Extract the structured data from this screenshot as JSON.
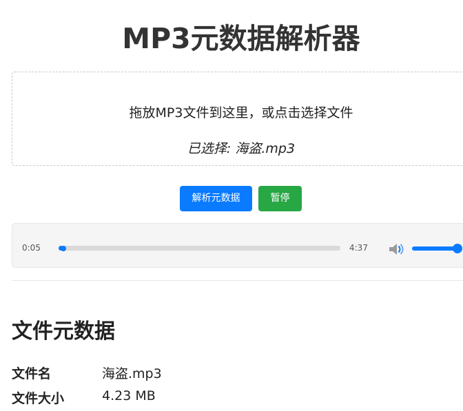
{
  "page": {
    "title": "MP3元数据解析器"
  },
  "dropzone": {
    "hint": "拖放MP3文件到这里，或点击选择文件",
    "selected": "已选择: 海盗.mp3"
  },
  "actions": {
    "parse_label": "解析元数据",
    "pause_label": "暂停"
  },
  "player": {
    "current_time": "0:05",
    "total_time": "4:37",
    "progress": 0.018,
    "volume": 1.0,
    "volume_icon": "speaker-icon"
  },
  "metadata": {
    "heading": "文件元数据",
    "rows": [
      {
        "label": "文件名",
        "value": "海盗.mp3"
      },
      {
        "label": "文件大小",
        "value": "4.23 MB"
      }
    ]
  },
  "colors": {
    "primary": "#0a7bff",
    "success": "#28a745"
  }
}
